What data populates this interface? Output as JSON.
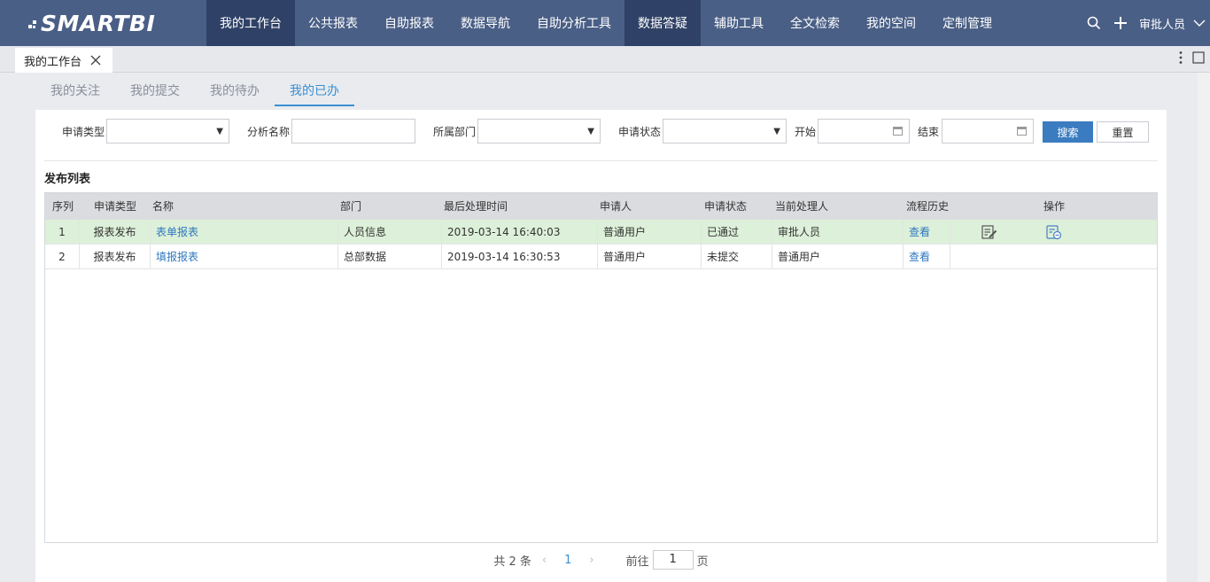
{
  "app": {
    "logo": "SMARTBI",
    "nav": [
      {
        "label": "我的工作台"
      },
      {
        "label": "公共报表"
      },
      {
        "label": "自助报表"
      },
      {
        "label": "数据导航"
      },
      {
        "label": "自助分析工具"
      },
      {
        "label": "数据答疑"
      },
      {
        "label": "辅助工具"
      },
      {
        "label": "全文检索"
      },
      {
        "label": "我的空间"
      },
      {
        "label": "定制管理"
      }
    ],
    "user": "审批人员"
  },
  "pagetab": {
    "label": "我的工作台"
  },
  "subtabs": [
    {
      "label": "我的关注"
    },
    {
      "label": "我的提交"
    },
    {
      "label": "我的待办"
    },
    {
      "label": "我的已办",
      "active": true
    }
  ],
  "filters": {
    "apply_type_label": "申请类型",
    "analysis_name_label": "分析名称",
    "dept_label": "所属部门",
    "apply_status_label": "申请状态",
    "start_label": "开始",
    "end_label": "结束",
    "search_button": "搜索",
    "reset_button": "重置"
  },
  "list": {
    "title": "发布列表",
    "columns": [
      "序列",
      "申请类型",
      "名称",
      "部门",
      "最后处理时间",
      "申请人",
      "申请状态",
      "当前处理人",
      "流程历史",
      "操作"
    ],
    "rows": [
      {
        "seq": "1",
        "type": "报表发布",
        "name": "表单报表",
        "dept": "人员信息",
        "time": "2019-03-14 16:40:03",
        "applicant": "普通用户",
        "status": "已通过",
        "handler": "审批人员",
        "history": "查看"
      },
      {
        "seq": "2",
        "type": "报表发布",
        "name": "填报报表",
        "dept": "总部数据",
        "time": "2019-03-14 16:30:53",
        "applicant": "普通用户",
        "status": "未提交",
        "handler": "普通用户",
        "history": "查看"
      }
    ]
  },
  "pager": {
    "total": "共 2 条",
    "current": "1",
    "goto_prefix": "前往",
    "goto_value": "1",
    "goto_suffix": "页"
  },
  "colors": {
    "nav_bg": "#4a5f86",
    "nav_active": "#2f4166",
    "accent": "#3a8fd1",
    "selected_row": "#ddf0d9"
  }
}
